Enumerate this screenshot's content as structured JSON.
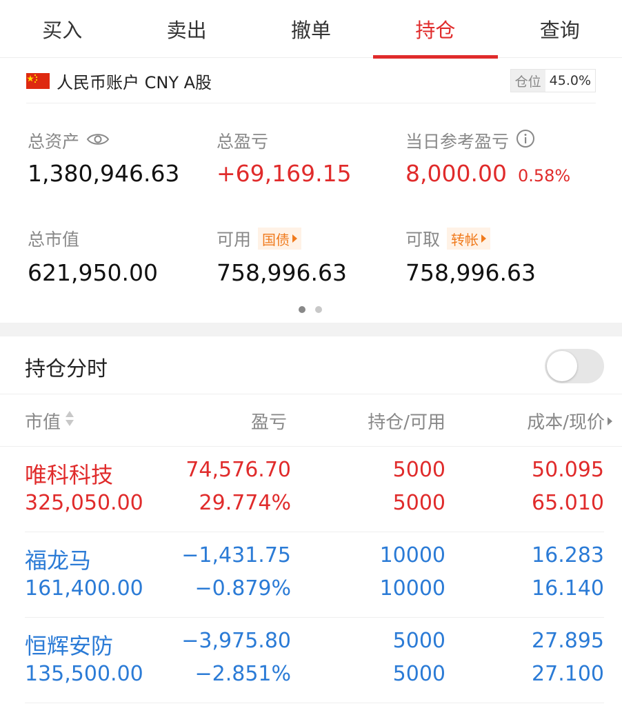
{
  "tabs": [
    "买入",
    "卖出",
    "撤单",
    "持仓",
    "查询"
  ],
  "active_tab": 3,
  "account": {
    "name": "人民币账户 CNY A股",
    "position_label": "仓位",
    "position_value": "45.0%"
  },
  "summary": {
    "total_assets_label": "总资产",
    "total_assets": "1,380,946.63",
    "total_pnl_label": "总盈亏",
    "total_pnl": "+69,169.15",
    "daily_pnl_label": "当日参考盈亏",
    "daily_pnl": "8,000.00",
    "daily_pnl_pct": "0.58%",
    "market_value_label": "总市值",
    "market_value": "621,950.00",
    "available_label": "可用",
    "available_tag": "国债",
    "available": "758,996.63",
    "withdrawable_label": "可取",
    "withdrawable_tag": "转帐",
    "withdrawable": "758,996.63"
  },
  "intraday": {
    "label": "持仓分时",
    "enabled": false
  },
  "table": {
    "headers": {
      "market_value": "市值",
      "pnl": "盈亏",
      "position": "持仓/可用",
      "cost_price": "成本/现价"
    },
    "rows": [
      {
        "name": "唯科科技",
        "market_value": "325,050.00",
        "pnl": "74,576.70",
        "pnl_pct": "29.774%",
        "holding": "5000",
        "available": "5000",
        "cost": "50.095",
        "price": "65.010",
        "trend": "up"
      },
      {
        "name": "福龙马",
        "market_value": "161,400.00",
        "pnl": "−1,431.75",
        "pnl_pct": "−0.879%",
        "holding": "10000",
        "available": "10000",
        "cost": "16.283",
        "price": "16.140",
        "trend": "down"
      },
      {
        "name": "恒辉安防",
        "market_value": "135,500.00",
        "pnl": "−3,975.80",
        "pnl_pct": "−2.851%",
        "holding": "5000",
        "available": "5000",
        "cost": "27.895",
        "price": "27.100",
        "trend": "down"
      }
    ]
  },
  "colors": {
    "accent": "#e02b2b",
    "loss": "#2b7bd6",
    "tag": "#f07a1c"
  },
  "pagination": {
    "pages": 2,
    "current": 1
  }
}
